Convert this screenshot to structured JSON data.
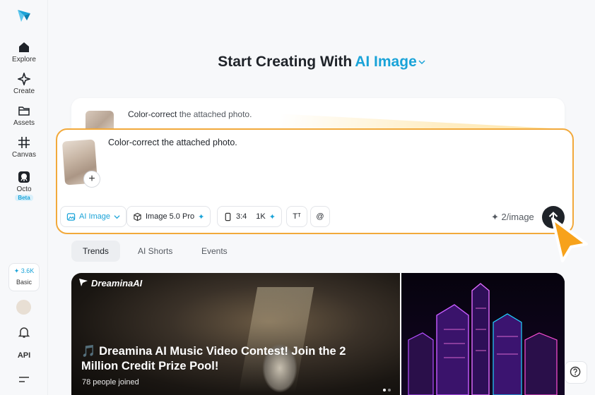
{
  "sidebar": {
    "logo": "app-logo",
    "items": [
      {
        "label": "Explore",
        "icon": "home-icon"
      },
      {
        "label": "Create",
        "icon": "sparkle-outline-icon"
      },
      {
        "label": "Assets",
        "icon": "folder-icon"
      },
      {
        "label": "Canvas",
        "icon": "canvas-grid-icon"
      },
      {
        "label": "Octo",
        "icon": "octo-icon",
        "badge": "Beta"
      }
    ],
    "credits": {
      "amount": "✦ 3.6K",
      "plan": "Basic"
    },
    "api_label": "API"
  },
  "header": {
    "title": "Start Creating With",
    "mode": "AI Image"
  },
  "previous_prompt": {
    "text_main": "Color-correct",
    "text_rest": " the attached photo."
  },
  "prompt": {
    "text": "Color-correct the attached photo.",
    "add_label": "+",
    "chips": {
      "mode": "AI Image",
      "model": "Image 5.0 Pro",
      "ratio": "3:4",
      "resolution": "1K",
      "text_icon": "Tᵀ",
      "mention": "@"
    },
    "cost": "2/image"
  },
  "tabs": [
    {
      "label": "Trends"
    },
    {
      "label": "AI Shorts"
    },
    {
      "label": "Events"
    }
  ],
  "banner": {
    "brand": "DreaminaAI",
    "title": "🎵 Dreamina AI Music Video Contest! Join the 2 Million Credit Prize Pool!",
    "joined": "78  people joined"
  },
  "colors": {
    "accent": "#1aa3d8",
    "focus_border": "#f2a93b",
    "cursor": "#f7a21b"
  }
}
